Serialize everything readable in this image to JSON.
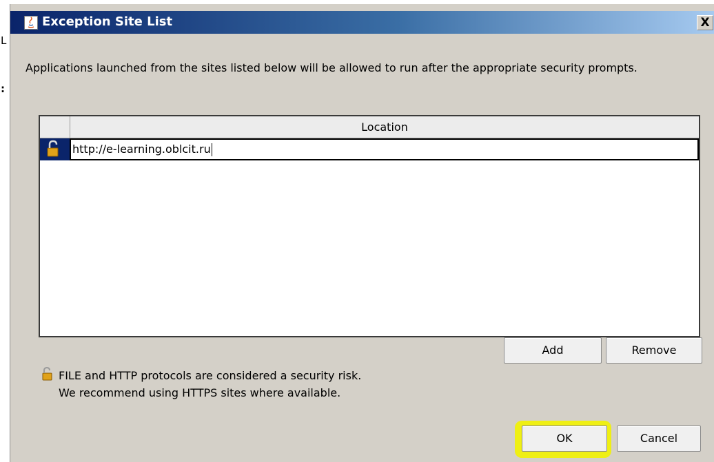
{
  "background": {
    "fragments": [
      "L",
      ":"
    ]
  },
  "dialog": {
    "title": "Exception Site List",
    "close_label": "X",
    "description": "Applications launched from the sites listed below will be allowed to run after the appropriate security prompts.",
    "table": {
      "column_header": "Location",
      "rows": [
        {
          "location": "http://e-learning.oblcit.ru",
          "icon": "unlocked-padlock-icon"
        }
      ]
    },
    "buttons": {
      "add": "Add",
      "remove": "Remove",
      "ok": "OK",
      "cancel": "Cancel"
    },
    "warning": {
      "icon": "unlocked-padlock-icon",
      "line1": "FILE and HTTP protocols are considered a security risk.",
      "line2": "We recommend using HTTPS sites where available."
    }
  },
  "colors": {
    "titlebar_start": "#0a246a",
    "titlebar_end": "#a6caf0",
    "highlight": "#f2f200",
    "dialog_bg": "#d4d0c8"
  }
}
